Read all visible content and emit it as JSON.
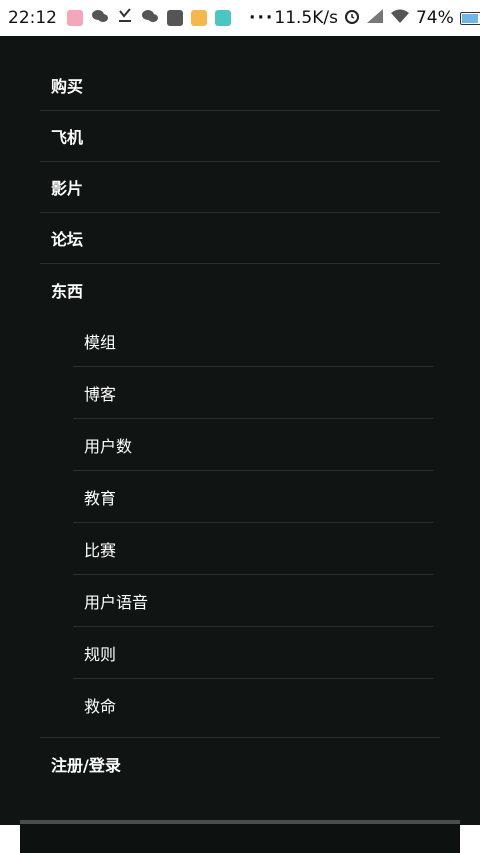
{
  "status_bar": {
    "time": "22:12",
    "dots": "···",
    "speed": "11.5K/s",
    "battery_text": "74%",
    "battery_level": 0.74,
    "icons": [
      "app-pink-icon",
      "wechat-icon",
      "download-icon",
      "wechat-icon",
      "grid-app-icon",
      "orange-app-icon",
      "teal-app-icon",
      "alarm-icon",
      "signal-icon",
      "wifi-icon"
    ]
  },
  "menu": {
    "items": [
      {
        "label": "购买"
      },
      {
        "label": "飞机"
      },
      {
        "label": "影片"
      },
      {
        "label": "论坛"
      },
      {
        "label": "东西"
      }
    ],
    "submenu": [
      {
        "label": "模组"
      },
      {
        "label": "博客"
      },
      {
        "label": "用户数"
      },
      {
        "label": "教育"
      },
      {
        "label": "比赛"
      },
      {
        "label": "用户语音"
      },
      {
        "label": "规则"
      },
      {
        "label": "救命"
      }
    ],
    "login_label": "注册/登录"
  },
  "colors": {
    "drawer_bg": "#101513",
    "divider": "#2a2f2d",
    "text": "#ffffff"
  }
}
